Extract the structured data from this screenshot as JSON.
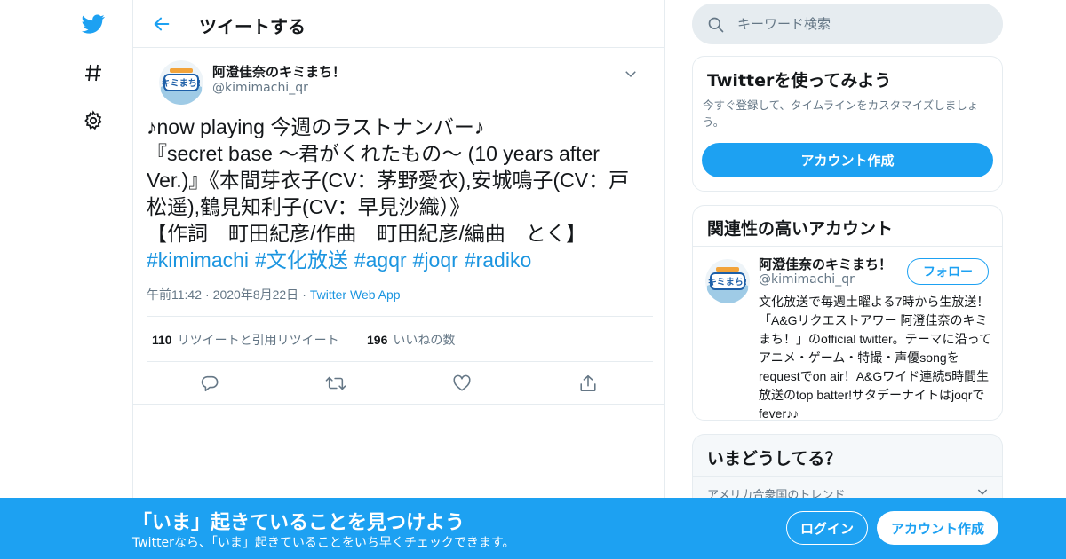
{
  "nav": {
    "icons": [
      "twitter-bird-icon",
      "hashtag-icon",
      "gear-icon"
    ]
  },
  "header": {
    "title": "ツイートする"
  },
  "tweet": {
    "author_name": "阿澄佳奈のキミまち！",
    "author_handle": "@kimimachi_qr",
    "lines": [
      "♪now playing 今週のラストナンバー♪",
      "『secret base 〜君がくれたもの〜 (10 years after",
      "Ver.)』《本間芽衣子(CV：茅野愛衣),安城鳴子(CV：戸",
      "松遥),鶴見知利子(CV：早見沙織）》",
      "【作詞　町田紀彦/作曲　町田紀彦/編曲　とく】"
    ],
    "hashtags": [
      "#kimimachi",
      "#文化放送",
      "#agqr",
      "#joqr",
      "#radiko"
    ],
    "time": "午前11:42",
    "date": "2020年8月22日",
    "source": "Twitter Web App",
    "separator": "·",
    "retweets_count": "110",
    "retweets_label": "リツイートと引用リツイート",
    "likes_count": "196",
    "likes_label": "いいねの数"
  },
  "search": {
    "placeholder": "キーワード検索"
  },
  "try_card": {
    "title": "Twitterを使ってみよう",
    "description": "今すぐ登録して、タイムラインをカスタマイズしましょう。",
    "button": "アカウント作成"
  },
  "related_card": {
    "title": "関連性の高いアカウント",
    "name": "阿澄佳奈のキミまち！",
    "handle": "@kimimachi_qr",
    "follow_label": "フォロー",
    "bio": "文化放送で毎週土曜よる7時から生放送！「A&Gリクエストアワー 阿澄佳奈のキミまち！」のofficial twitter。テーマに沿ってアニメ・ゲーム・特撮・声優songをrequestでon air！A&Gワイド連続5時間生放送のtop batter!サタデーナイトはjoqrでfever♪♪"
  },
  "trends_card": {
    "title": "いまどうしてる？",
    "subtitle": "アメリカ合衆国のトレンド"
  },
  "bottom_bar": {
    "title": "「いま」起きていることを見つけよう",
    "subtitle": "Twitterなら、「いま」起きていることをいち早くチェックできます。",
    "login": "ログイン",
    "signup": "アカウント作成"
  },
  "colors": {
    "brand": "#1da1f2",
    "link": "#1b95e0",
    "secondary_text": "#657786",
    "border": "#e6ecf0"
  }
}
